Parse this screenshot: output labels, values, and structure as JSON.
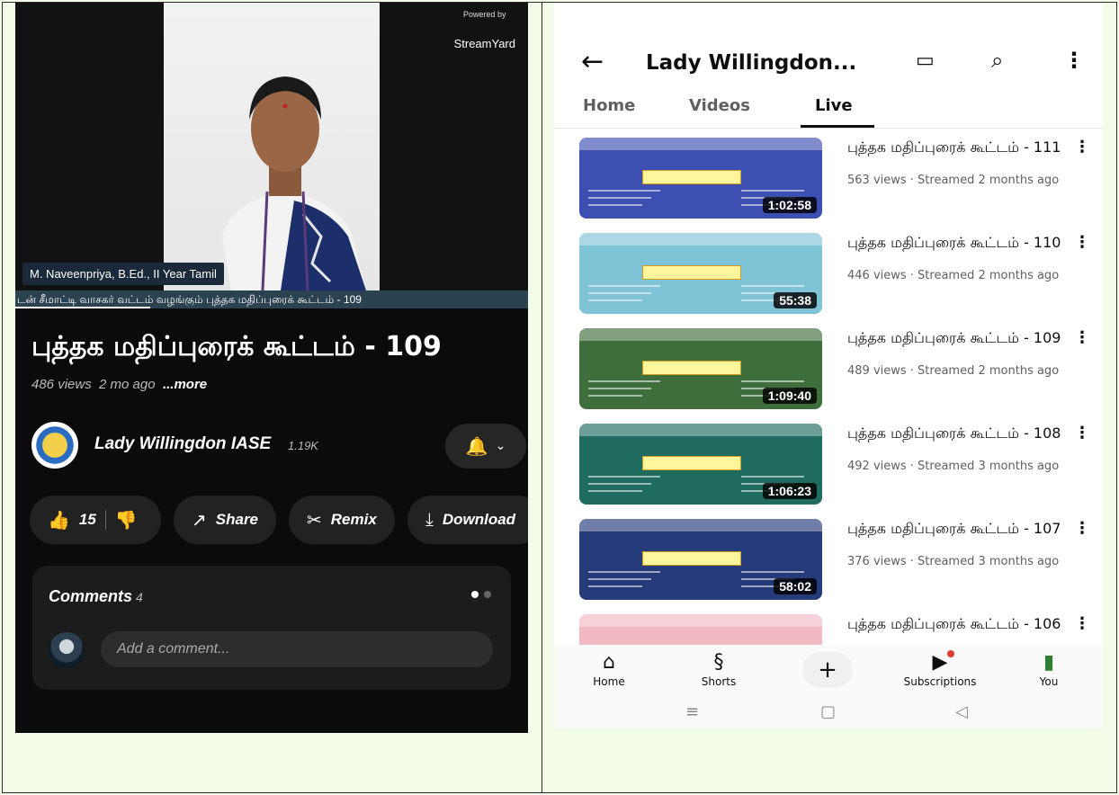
{
  "left": {
    "overlay": {
      "powered_by": "Powered by",
      "streamyard": "StreamYard",
      "nameplate": "M. Naveenpriya, B.Ed., II Year Tamil",
      "ticker": "டன் சீமாட்டி வாசகர் வட்டம் வழங்கும் புத்தக மதிப்புரைக் கூட்டம் - 109"
    },
    "title": "புத்தக மதிப்புரைக் கூட்டம் - 109",
    "views": "486 views",
    "ago": "2 mo ago",
    "more": "...more",
    "channel": {
      "name": "Lady Willingdon IASE",
      "subs": "1.19K"
    },
    "actions": {
      "likes": "15",
      "share": "Share",
      "remix": "Remix",
      "download": "Download"
    },
    "comments": {
      "title": "Comments",
      "count": "4",
      "placeholder": "Add a comment..."
    }
  },
  "right": {
    "header": {
      "title": "Lady Willingdon..."
    },
    "tabs": [
      {
        "label": "Home"
      },
      {
        "label": "Videos"
      },
      {
        "label": "Live"
      }
    ],
    "videos": [
      {
        "title": "புத்தக மதிப்புரைக் கூட்டம் - 111",
        "meta": "563 views · Streamed 2 months ago",
        "duration": "1:02:58",
        "color": "#3d4fb0"
      },
      {
        "title": "புத்தக மதிப்புரைக் கூட்டம் - 110",
        "meta": "446 views · Streamed 2 months ago",
        "duration": "55:38",
        "color": "#7fc3d6"
      },
      {
        "title": "புத்தக மதிப்புரைக் கூட்டம் - 109",
        "meta": "489 views · Streamed 2 months ago",
        "duration": "1:09:40",
        "color": "#3f6e3d"
      },
      {
        "title": "புத்தக மதிப்புரைக் கூட்டம் - 108",
        "meta": "492 views · Streamed 3 months ago",
        "duration": "1:06:23",
        "color": "#1f6b60"
      },
      {
        "title": "புத்தக மதிப்புரைக் கூட்டம் - 107",
        "meta": "376 views · Streamed 3 months ago",
        "duration": "58:02",
        "color": "#263b7a"
      },
      {
        "title": "புத்தக மதிப்புரைக் கூட்டம் - 106",
        "meta": "",
        "duration": "",
        "color": "#f2b9c3"
      }
    ],
    "nav": {
      "home": "Home",
      "shorts": "Shorts",
      "subscriptions": "Subscriptions",
      "you": "You"
    }
  }
}
